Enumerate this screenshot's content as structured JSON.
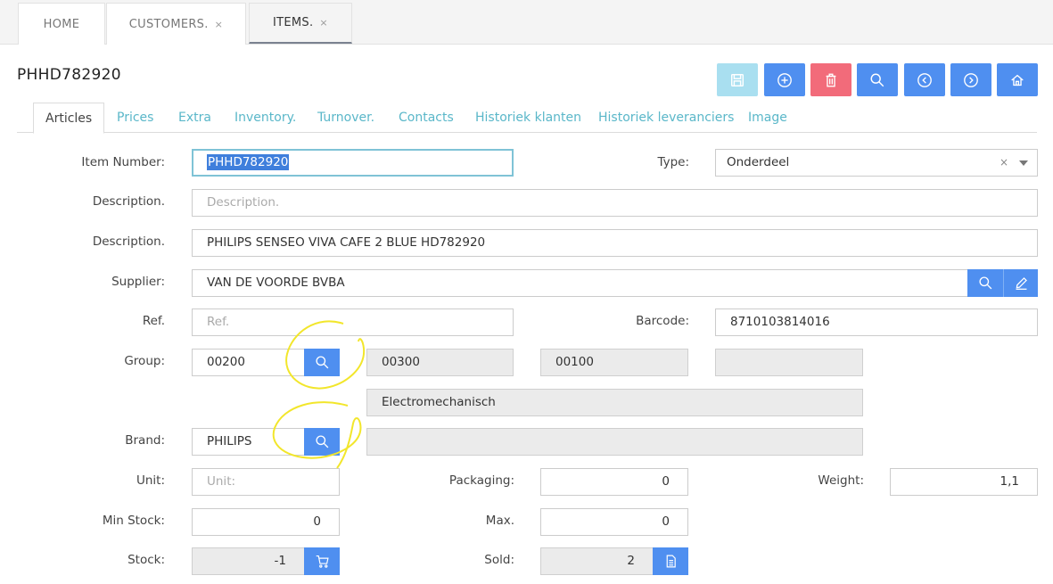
{
  "top_tabs": [
    {
      "label": "HOME"
    },
    {
      "label": "CUSTOMERS.",
      "close": "×"
    },
    {
      "label": "ITEMS.",
      "close": "×"
    }
  ],
  "page": {
    "title": "PHHD782920"
  },
  "toolbar": [
    "save-icon",
    "add-icon",
    "delete-icon",
    "search-icon",
    "previous-icon",
    "next-icon",
    "home-icon"
  ],
  "colors": {
    "save": "#a9dff0",
    "action": "#4f8ff0",
    "delete": "#f26b7a",
    "link": "#5ab7c9",
    "annotation": "#f2e62b"
  },
  "sub_tabs": [
    "Articles",
    "Prices",
    "Extra",
    "Inventory.",
    "Turnover.",
    "Contacts",
    "Historiek klanten",
    "Historiek leveranciers",
    "Image"
  ],
  "form": {
    "item_number": {
      "label": "Item Number:",
      "value": "PHHD782920"
    },
    "type": {
      "label": "Type:",
      "value": "Onderdeel",
      "clear": "×"
    },
    "description1": {
      "label": "Description.",
      "placeholder": "Description."
    },
    "description2": {
      "label": "Description.",
      "value": "PHILIPS SENSEO VIVA CAFE 2 BLUE HD782920"
    },
    "supplier": {
      "label": "Supplier:",
      "value": "VAN DE VOORDE BVBA"
    },
    "ref": {
      "label": "Ref.",
      "placeholder": "Ref."
    },
    "barcode": {
      "label": "Barcode:",
      "value": "8710103814016"
    },
    "group": {
      "label": "Group:",
      "value": "00200",
      "sub1": "00300",
      "sub2": "00100",
      "sub3": "",
      "description": "Electromechanisch"
    },
    "brand": {
      "label": "Brand:",
      "value": "PHILIPS",
      "description": ""
    },
    "unit": {
      "label": "Unit:",
      "placeholder": "Unit:"
    },
    "packaging": {
      "label": "Packaging:",
      "value": "0"
    },
    "weight": {
      "label": "Weight:",
      "value": "1,1"
    },
    "min_stock": {
      "label": "Min Stock:",
      "value": "0"
    },
    "max": {
      "label": "Max.",
      "value": "0"
    },
    "stock": {
      "label": "Stock:",
      "value": "-1"
    },
    "sold": {
      "label": "Sold:",
      "value": "2"
    }
  }
}
